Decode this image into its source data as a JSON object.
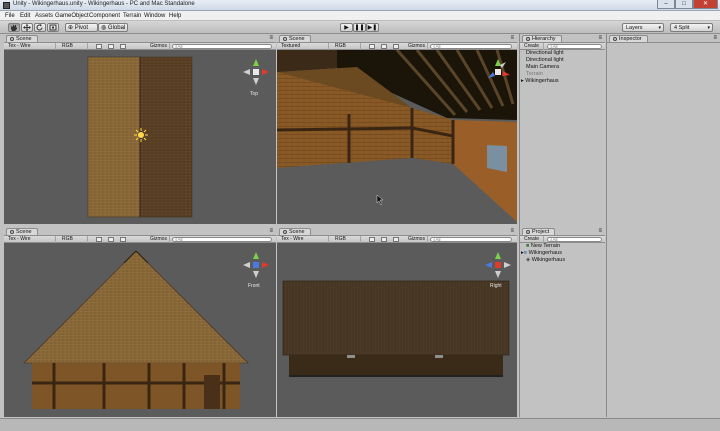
{
  "window": {
    "title": "Unity - Wikingerhaus.unity - Wikingerhaus - PC and Mac Standalone",
    "min_glyph": "–",
    "max_glyph": "□",
    "close_glyph": "✕"
  },
  "menu": [
    "File",
    "Edit",
    "Assets",
    "GameObject",
    "Component",
    "Terrain",
    "Window",
    "Help"
  ],
  "toolbar": {
    "pivot": "Pivot",
    "global": "Global",
    "play_glyph": "▶",
    "pause_glyph": "❚❚",
    "step_glyph": "▶❚",
    "layers": "Layers",
    "layout": "4 Split"
  },
  "scenes": [
    {
      "tab": "Scene",
      "render": "Tex - Wire",
      "channel": "RGB",
      "gizmos": "Gizmos",
      "search": "All",
      "label": "Top"
    },
    {
      "tab": "Scene",
      "render": "Textured",
      "channel": "RGB",
      "gizmos": "Gizmos",
      "search": "All",
      "label": ""
    },
    {
      "tab": "Scene",
      "render": "Tex - Wire",
      "channel": "RGB",
      "gizmos": "Gizmos",
      "search": "All",
      "label": "Front"
    },
    {
      "tab": "Scene",
      "render": "Tex - Wire",
      "channel": "RGB",
      "gizmos": "Gizmos",
      "search": "All",
      "label": "Right"
    }
  ],
  "hierarchy": {
    "tab": "Hierarchy",
    "create": "Create",
    "search": "All",
    "items": [
      "Directional light",
      "Directional light",
      "Main Camera",
      "Terrain",
      "Wikingerhaus"
    ]
  },
  "project": {
    "tab": "Project",
    "create": "Create",
    "search": "All",
    "items": [
      "New Terrain",
      "Wikingerhaus",
      "Wikingerhaus"
    ]
  },
  "inspector": {
    "tab": "Inspector"
  },
  "icons": {
    "transform_tools": [
      "hand-icon",
      "move-icon",
      "rotate-icon",
      "scale-icon"
    ],
    "light": "sun-icon",
    "gizmo": "axis-gizmo-icon"
  },
  "colors": {
    "panel": "#c2c2c2",
    "viewport": "#5b5b5b",
    "thatch": "#8c6a3a",
    "wood": "#6b4a22",
    "close": "#c24133"
  }
}
